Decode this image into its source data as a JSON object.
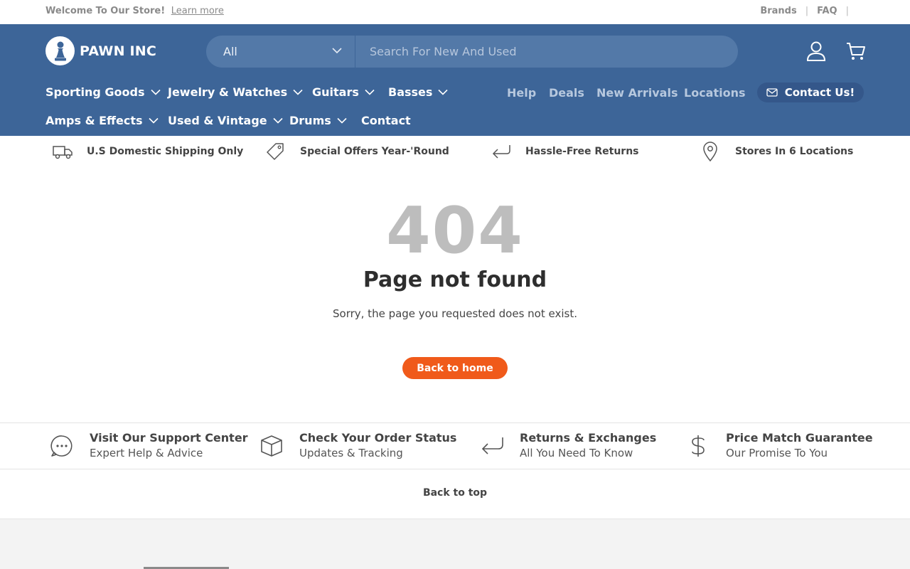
{
  "announcement": {
    "welcome": "Welcome To Our Store!",
    "learn_more": "Learn more",
    "links": [
      "Brands",
      "FAQ"
    ],
    "separator": "|"
  },
  "header": {
    "brand": "PAWN INC",
    "search": {
      "category": "All",
      "placeholder": "Search For New And Used"
    },
    "icons": [
      "account-icon",
      "cart-icon"
    ],
    "nav_main": [
      {
        "label": "Sporting Goods",
        "has_dropdown": true
      },
      {
        "label": "Jewelry & Watches",
        "has_dropdown": true
      },
      {
        "label": "Guitars",
        "has_dropdown": true
      },
      {
        "label": "Basses",
        "has_dropdown": true
      },
      {
        "label": "Amps & Effects",
        "has_dropdown": true
      },
      {
        "label": "Used & Vintage",
        "has_dropdown": true
      },
      {
        "label": "Drums",
        "has_dropdown": true
      },
      {
        "label": "Contact",
        "has_dropdown": false
      }
    ],
    "nav_secondary": [
      "Help",
      "Deals",
      "New Arrivals",
      "Locations"
    ],
    "contact_button": "Contact Us!"
  },
  "usp": [
    {
      "icon": "truck-icon",
      "label": "U.S Domestic Shipping Only"
    },
    {
      "icon": "tag-icon",
      "label": "Special Offers Year-'Round"
    },
    {
      "icon": "return-arrow-icon",
      "label": "Hassle-Free Returns"
    },
    {
      "icon": "map-pin-icon",
      "label": "Stores In 6 Locations"
    }
  ],
  "error": {
    "code": "404",
    "title": "Page not found",
    "message": "Sorry, the page you requested does not exist.",
    "button": "Back to home"
  },
  "features": [
    {
      "icon": "chat-bubble-icon",
      "title": "Visit Our Support Center",
      "subtitle": "Expert Help & Advice"
    },
    {
      "icon": "box-icon",
      "title": "Check Your Order Status",
      "subtitle": "Updates & Tracking"
    },
    {
      "icon": "return-arrow-icon",
      "title": "Returns & Exchanges",
      "subtitle": "All You Need To Know"
    },
    {
      "icon": "dollar-icon",
      "title": "Price Match Guarantee",
      "subtitle": "Our Promise To You"
    }
  ],
  "back_to_top": "Back to top",
  "colors": {
    "header_bg": "#3d6598",
    "accent": "#f05a1a",
    "error_code": "#bdbdbd"
  }
}
